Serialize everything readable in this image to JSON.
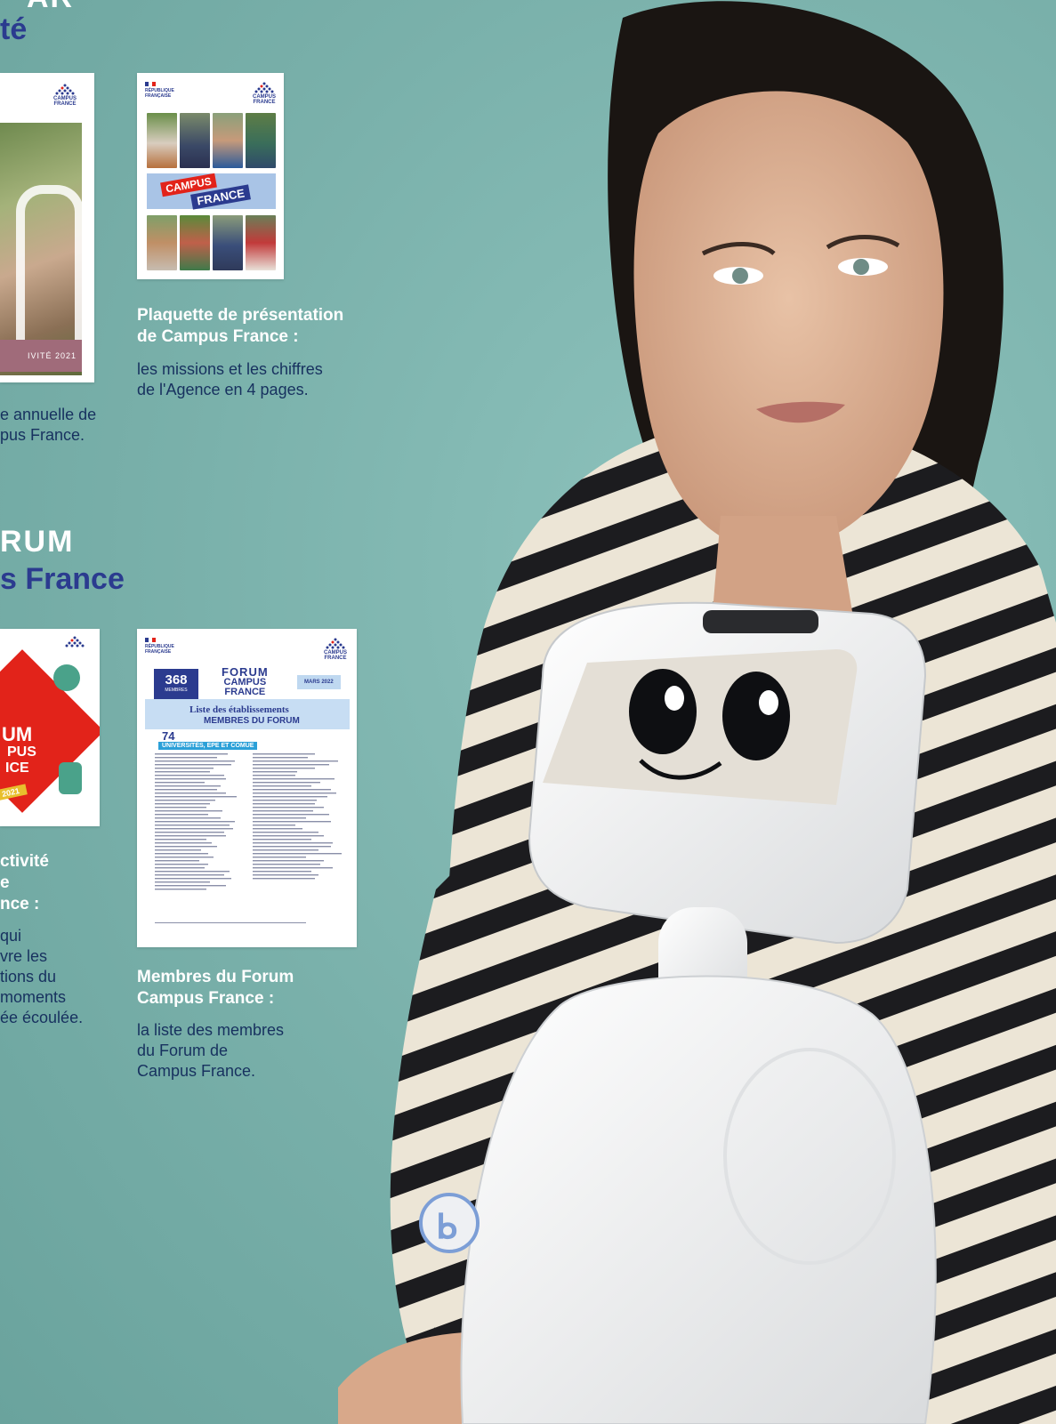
{
  "headings": {
    "top_line2": "té",
    "mid_line1": "RUM",
    "mid_line2": "s France"
  },
  "logo": {
    "cf_word1": "CAMPUS",
    "cf_word2": "FRANCE",
    "rf_line1": "RÉPUBLIQUE",
    "rf_line2": "FRANÇAISE"
  },
  "cover_activity": {
    "year_label": "IVITÉ 2021"
  },
  "cover_plaquette": {
    "banner_top": "CAMPUS",
    "banner_bottom": "FRANCE"
  },
  "caption_plaquette": {
    "title_1": "Plaquette de présentation",
    "title_2": "de Campus France :",
    "body_1": "les missions et les chiffres",
    "body_2": "de l'Agence en 4 pages."
  },
  "caption_activity": {
    "body_1": "e annuelle de",
    "body_2": "pus France."
  },
  "cover_forum_activity": {
    "year": "2021",
    "word1": "UM",
    "word2": "PUS",
    "word3": "ICE"
  },
  "caption_forum_activity": {
    "title_1": "ctivité",
    "title_2": "e",
    "title_3": "nce :",
    "body_1": "qui",
    "body_2": "vre les",
    "body_3": "tions du",
    "body_4": "moments",
    "body_5": "ée écoulée."
  },
  "cover_members": {
    "count": "368",
    "count_label": "MEMBRES",
    "forum_word": "FORUM",
    "cf_word1": "CAMPUS",
    "cf_word2": "FRANCE",
    "date": "MARS 2022",
    "list_title_1": "Liste des établissements",
    "list_title_2": "MEMBRES DU FORUM",
    "sub_count": "74",
    "sub_label": "UNIVERSITÉS, EPE ET COMUE"
  },
  "caption_members": {
    "title_1": "Membres du Forum",
    "title_2": "Campus France :",
    "body_1": "la liste des membres",
    "body_2": "du Forum de",
    "body_3": "Campus  France."
  },
  "colors": {
    "background": "#7fb4ae",
    "navy": "#2b3b8f",
    "caption_body": "#17315f",
    "accent_red": "#e2231a"
  }
}
